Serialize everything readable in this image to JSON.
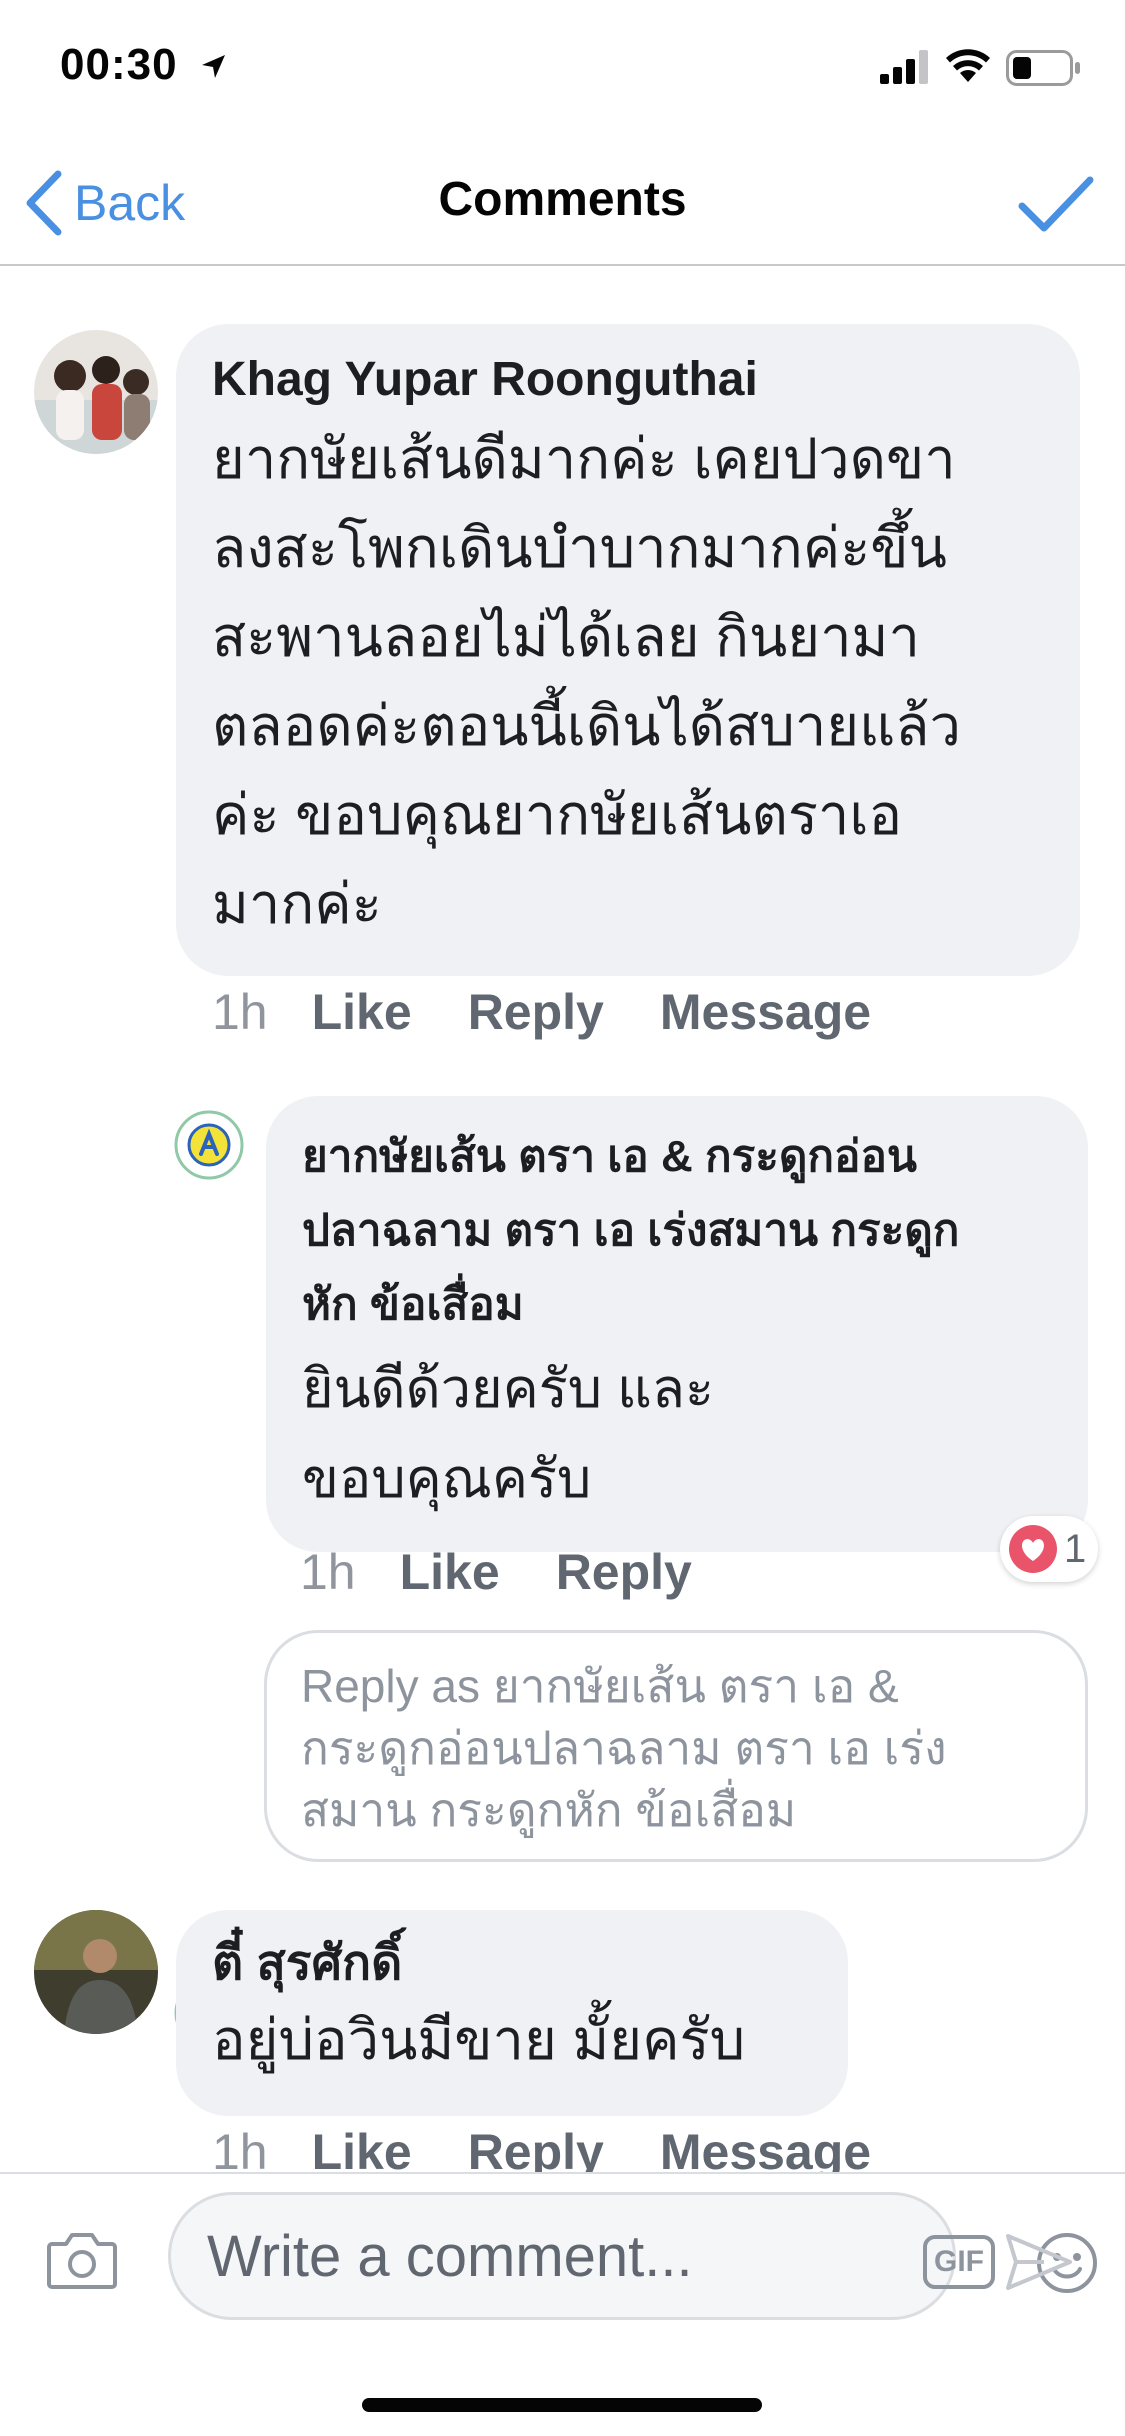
{
  "status_bar": {
    "time": "00:30"
  },
  "nav": {
    "back_label": "Back",
    "title": "Comments"
  },
  "comments": [
    {
      "author": "Khag Yupar Roonguthai",
      "text_lines": [
        "ยากษัยเส้นดีมากค่ะ เคยปวดขา",
        "ลงสะโพกเดินบำบากมากค่ะขึ้น",
        "สะพานลอยไม่ได้เลย กินยามา",
        "ตลอดค่ะตอนนี้เดินได้สบายแล้ว",
        "ค่ะ ขอบคุณยากษัยเส้นตราเอ",
        "มากค่ะ"
      ],
      "time": "1h",
      "like": "Like",
      "reply": "Reply",
      "message": "Message"
    },
    {
      "author_lines": [
        "ยากษัยเส้น ตรา เอ & กระดูกอ่อน",
        "ปลาฉลาม ตรา เอ เร่งสมาน กระดูก",
        "หัก ข้อเสื่อม"
      ],
      "text_lines": [
        "ยินดีด้วยครับ และ",
        "ขอบคุณครับ"
      ],
      "time": "1h",
      "like": "Like",
      "reply": "Reply",
      "reaction_count": "1"
    },
    {
      "author": "ตี๋ สุรศักดิ์",
      "text_lines": [
        "อยู่บ่อวินมีขาย มั้ยครับ"
      ],
      "time": "1h",
      "like": "Like",
      "reply": "Reply",
      "message": "Message"
    }
  ],
  "reply_box": {
    "lines": [
      "Reply as ยากษัยเส้น ตรา เอ &",
      "กระดูกอ่อนปลาฉลาม ตรา เอ เร่ง",
      "สมาน กระดูกหัก ข้อเสื่อม"
    ]
  },
  "composer": {
    "placeholder": "Write a comment...",
    "gif_label": "GIF"
  },
  "colors": {
    "accent": "#4a90e2",
    "bubble": "#f0f1f4",
    "reaction": "#e9546b"
  }
}
